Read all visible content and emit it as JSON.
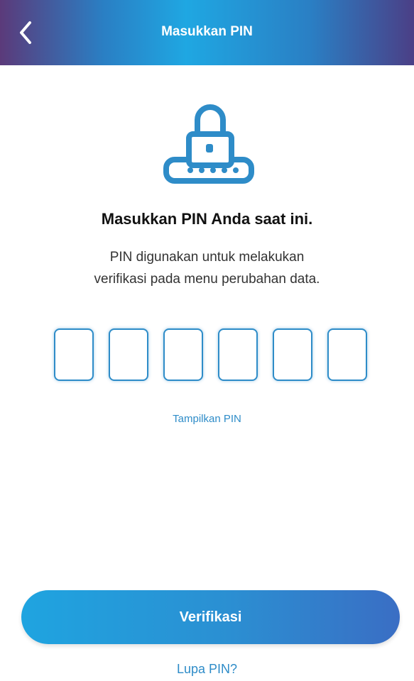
{
  "header": {
    "title": "Masukkan PIN",
    "back_icon": "chevron-left-icon"
  },
  "illustration": {
    "icon": "lock-keypad-icon",
    "color": "#2e8cc8"
  },
  "content": {
    "heading": "Masukkan PIN Anda saat ini.",
    "description_line1": "PIN digunakan untuk melakukan",
    "description_line2": "verifikasi pada menu perubahan data."
  },
  "pin": {
    "digits": [
      "",
      "",
      "",
      "",
      "",
      ""
    ],
    "show_pin_label": "Tampilkan PIN"
  },
  "actions": {
    "verify_label": "Verifikasi",
    "forgot_label": "Lupa PIN?"
  },
  "colors": {
    "accent": "#2e8cc8",
    "button": "#1fa4e0"
  }
}
